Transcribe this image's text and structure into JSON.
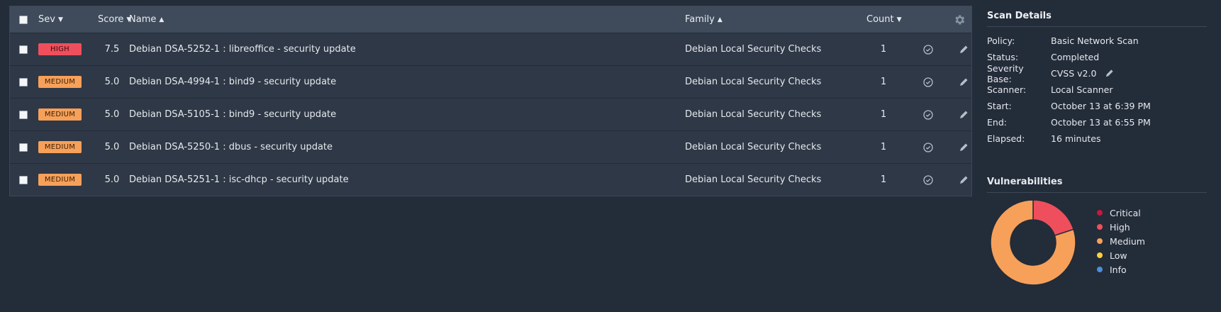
{
  "table": {
    "headers": {
      "sev": "Sev",
      "score": "Score",
      "name": "Name",
      "family": "Family",
      "count": "Count"
    },
    "rows": [
      {
        "sev": "HIGH",
        "sev_level": "high",
        "score": "7.5",
        "name": "Debian DSA-5252-1 : libreoffice - security update",
        "family": "Debian Local Security Checks",
        "count": "1"
      },
      {
        "sev": "MEDIUM",
        "sev_level": "medium",
        "score": "5.0",
        "name": "Debian DSA-4994-1 : bind9 - security update",
        "family": "Debian Local Security Checks",
        "count": "1"
      },
      {
        "sev": "MEDIUM",
        "sev_level": "medium",
        "score": "5.0",
        "name": "Debian DSA-5105-1 : bind9 - security update",
        "family": "Debian Local Security Checks",
        "count": "1"
      },
      {
        "sev": "MEDIUM",
        "sev_level": "medium",
        "score": "5.0",
        "name": "Debian DSA-5250-1 : dbus - security update",
        "family": "Debian Local Security Checks",
        "count": "1"
      },
      {
        "sev": "MEDIUM",
        "sev_level": "medium",
        "score": "5.0",
        "name": "Debian DSA-5251-1 : isc-dhcp - security update",
        "family": "Debian Local Security Checks",
        "count": "1"
      }
    ]
  },
  "scan_details": {
    "title": "Scan Details",
    "items": [
      {
        "label": "Policy:",
        "value": "Basic Network Scan"
      },
      {
        "label": "Status:",
        "value": "Completed"
      },
      {
        "label": "Severity Base:",
        "value": "CVSS v2.0"
      },
      {
        "label": "Scanner:",
        "value": "Local Scanner"
      },
      {
        "label": "Start:",
        "value": "October 13 at 6:39 PM"
      },
      {
        "label": "End:",
        "value": "October 13 at 6:55 PM"
      },
      {
        "label": "Elapsed:",
        "value": "16 minutes"
      }
    ]
  },
  "vulnerabilities": {
    "title": "Vulnerabilities",
    "legend": [
      {
        "label": "Critical",
        "color": "#c8183e"
      },
      {
        "label": "High",
        "color": "#ef4f5c"
      },
      {
        "label": "Medium",
        "color": "#f7a05a"
      },
      {
        "label": "Low",
        "color": "#fdd03b"
      },
      {
        "label": "Info",
        "color": "#4a90d6"
      }
    ]
  },
  "chart_data": {
    "type": "pie",
    "categories": [
      "Critical",
      "High",
      "Medium",
      "Low",
      "Info"
    ],
    "values": [
      0,
      1,
      4,
      0,
      0
    ]
  }
}
